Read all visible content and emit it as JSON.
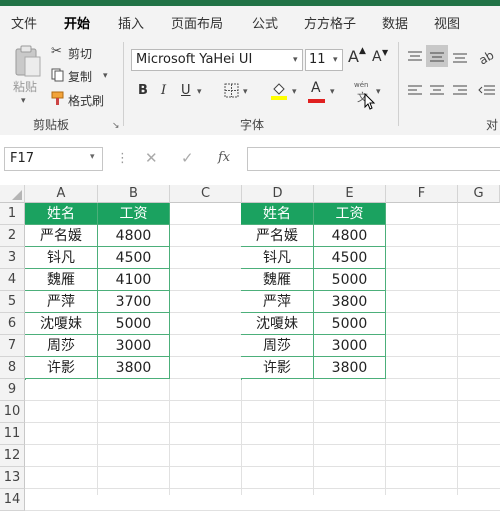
{
  "tabs": [
    "文件",
    "开始",
    "插入",
    "页面布局",
    "公式",
    "方方格子",
    "数据",
    "视图"
  ],
  "ribbon": {
    "paste_label": "粘贴",
    "cut_label": "剪切",
    "copy_label": "复制",
    "format_painter_label": "格式刷",
    "clipboard_group": "剪贴板",
    "font_name": "Microsoft YaHei UI",
    "font_size": "11",
    "font_group": "字体",
    "align_group_partial": "对",
    "bold": "B",
    "italic": "I",
    "underline": "U",
    "increase_font": "A",
    "decrease_font": "A",
    "font_color_letter": "A",
    "wen": "wén",
    "wen_char": "文",
    "colors": {
      "highlight": "#ffff00",
      "font": "#e02020",
      "accent": "#217346",
      "header_fill": "#1ba260"
    }
  },
  "formula_bar": {
    "name_box": "F17",
    "fx": "fx",
    "value": ""
  },
  "columns": [
    "A",
    "B",
    "C",
    "D",
    "E",
    "F",
    "G"
  ],
  "rows": [
    "1",
    "2",
    "3",
    "4",
    "5",
    "6",
    "7",
    "8",
    "9",
    "10",
    "11",
    "12",
    "13",
    "14"
  ],
  "table1": {
    "headers": [
      "姓名",
      "工资"
    ],
    "rows": [
      [
        "严名媛",
        "4800"
      ],
      [
        "钭凡",
        "4500"
      ],
      [
        "魏雁",
        "4100"
      ],
      [
        "严萍",
        "3700"
      ],
      [
        "沈嗄妹",
        "5000"
      ],
      [
        "周莎",
        "3000"
      ],
      [
        "许影",
        "3800"
      ]
    ]
  },
  "table2": {
    "headers": [
      "姓名",
      "工资"
    ],
    "rows": [
      [
        "严名媛",
        "4800"
      ],
      [
        "钭凡",
        "4500"
      ],
      [
        "魏雁",
        "5000"
      ],
      [
        "严萍",
        "3800"
      ],
      [
        "沈嗄妹",
        "5000"
      ],
      [
        "周莎",
        "3000"
      ],
      [
        "许影",
        "3800"
      ]
    ]
  }
}
